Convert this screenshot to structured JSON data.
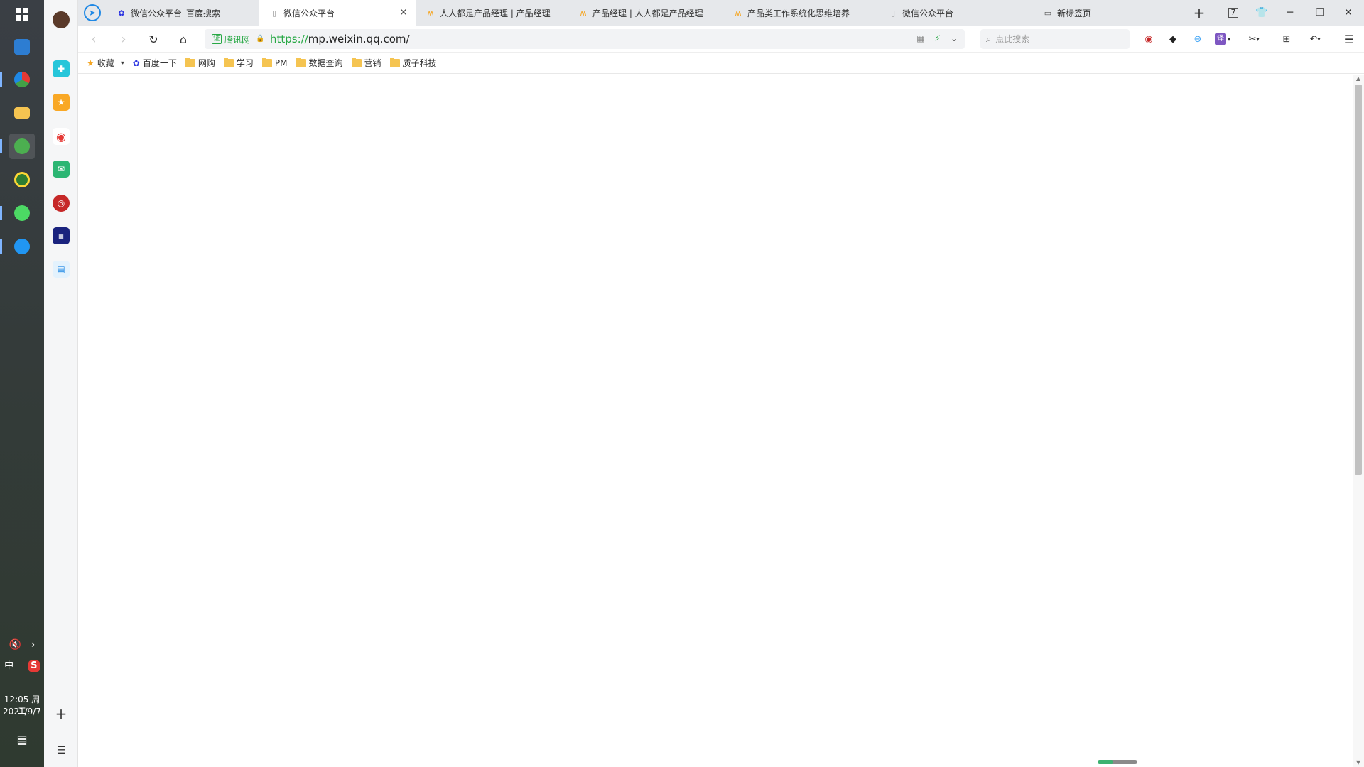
{
  "taskbar": {
    "clock_time": "12:05 周二",
    "clock_date": "2021/9/7",
    "ime_label": "中",
    "sogou_label": "S"
  },
  "tabs": [
    {
      "title": "微信公众平台_百度搜索",
      "favicon": "baidu-icon",
      "active": false
    },
    {
      "title": "微信公众平台",
      "favicon": "page-icon",
      "active": true
    },
    {
      "title": "人人都是产品经理 | 产品经理",
      "favicon": "woshipm-icon",
      "active": false
    },
    {
      "title": "产品经理 | 人人都是产品经理",
      "favicon": "woshipm-icon",
      "active": false
    },
    {
      "title": "产品类工作系统化思维培养",
      "favicon": "woshipm-icon",
      "active": false
    },
    {
      "title": "微信公众平台",
      "favicon": "page-icon",
      "active": false
    },
    {
      "title": "新标签页",
      "favicon": "newtab-icon",
      "active": false
    }
  ],
  "tabstrip": {
    "new_tab": "+",
    "tab_count": "7"
  },
  "address": {
    "verify_badge": "证",
    "verify_label": "腾讯网",
    "url_scheme": "https://",
    "url_rest": "mp.weixin.qq.com/"
  },
  "search": {
    "placeholder": "点此搜索"
  },
  "toolbar": {
    "translate_label": "译"
  },
  "bookmarks": [
    {
      "label": "收藏",
      "type": "star"
    },
    {
      "label": "百度一下",
      "type": "baidu"
    },
    {
      "label": "网购",
      "type": "folder"
    },
    {
      "label": "学习",
      "type": "folder"
    },
    {
      "label": "PM",
      "type": "folder"
    },
    {
      "label": "数据查询",
      "type": "folder"
    },
    {
      "label": "营销",
      "type": "folder"
    },
    {
      "label": "质子科技",
      "type": "folder"
    }
  ],
  "sidebar": {
    "add": "+"
  },
  "colors": {
    "secure_green": "#27a844",
    "tab_strip": "#e6e8eb",
    "taskbar": "#343b3a"
  },
  "load_progress": 0.4
}
